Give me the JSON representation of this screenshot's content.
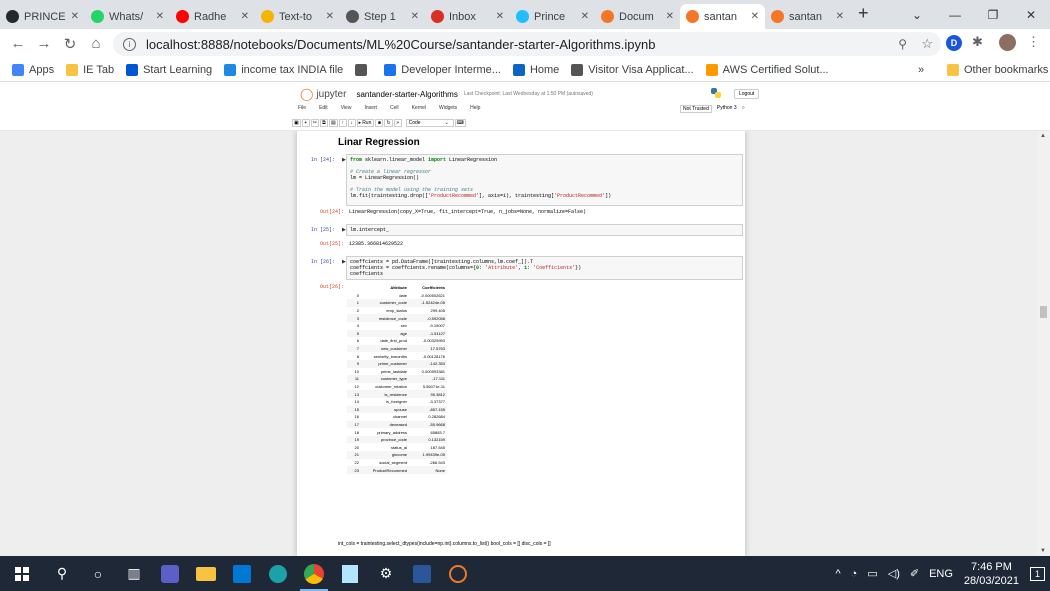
{
  "tabs": [
    {
      "label": "PRINCE",
      "icon": "github-icon",
      "color": "#24292e"
    },
    {
      "label": "Whats/",
      "icon": "whatsapp-icon",
      "color": "#25d366"
    },
    {
      "label": "Radhe",
      "icon": "youtube-icon",
      "color": "#ff0000"
    },
    {
      "label": "Text-to",
      "icon": "google-drive-icon",
      "color": "#f4b400"
    },
    {
      "label": "Step 1",
      "icon": "github-icon",
      "color": "#555555"
    },
    {
      "label": "Inbox",
      "icon": "gmail-icon",
      "color": "#d93025"
    },
    {
      "label": "Prince",
      "icon": "kaggle-icon",
      "color": "#20beff"
    },
    {
      "label": "Docum",
      "icon": "jupyter-icon",
      "color": "#f37726"
    },
    {
      "label": "santan",
      "icon": "notebook-icon",
      "color": "#f37726"
    },
    {
      "label": "santan",
      "icon": "notebook-icon",
      "color": "#f37726"
    }
  ],
  "active_tab": 8,
  "url": "localhost:8888/notebooks/Documents/ML%20Course/santander-starter-Algorithms.ipynb",
  "bookmarks": [
    {
      "label": "Apps",
      "icon": "apps-grid-icon",
      "color": "#4285f4"
    },
    {
      "label": "IE Tab",
      "icon": "folder-icon",
      "color": "#f6c343"
    },
    {
      "label": "Start Learning",
      "icon": "coursera-icon",
      "color": "#0056d2"
    },
    {
      "label": "income tax INDIA file",
      "icon": "ie-icon",
      "color": "#1e88e5"
    },
    {
      "label": "",
      "icon": "globe-icon",
      "color": "#555555"
    },
    {
      "label": "Developer Interme...",
      "icon": "developer-icon",
      "color": "#1a73e8"
    },
    {
      "label": "Home",
      "icon": "linkedin-icon",
      "color": "#0a66c2"
    },
    {
      "label": "Visitor Visa Applicat...",
      "icon": "globe-icon",
      "color": "#555555"
    },
    {
      "label": "AWS Certified Solut...",
      "icon": "aws-icon",
      "color": "#ff9900"
    }
  ],
  "other_bookmarks": "Other bookmarks",
  "jupyter": {
    "title": "santander-starter-Algorithms",
    "checkpoint": "Last Checkpoint: Last Wednesday at 1:50 PM  (autosaved)",
    "logout": "Logout",
    "menus": [
      "File",
      "Edit",
      "View",
      "Insert",
      "Cell",
      "Kernel",
      "Widgets",
      "Help"
    ],
    "trusted": "Not Trusted",
    "kernel": "Python 3",
    "run": "Run",
    "celltype": "Code"
  },
  "notebook": {
    "heading": "Linar Regression",
    "cell1": {
      "prompt": "In [24]:",
      "out_prompt": "Out[24]:",
      "output": "LinearRegression(copy_X=True, fit_intercept=True, n_jobs=None, normalize=False)"
    },
    "cell2": {
      "prompt": "In [25]:",
      "code": "lm.intercept_",
      "out_prompt": "Out[25]:",
      "output": "12385.366814629522"
    },
    "cell3": {
      "prompt": "In [26]:",
      "out_prompt": "Out[26]:"
    },
    "table": {
      "columns": [
        "",
        "Attribute",
        "Coefficients"
      ],
      "rows": [
        [
          "0",
          "date",
          "-0.000502621"
        ],
        [
          "1",
          "customer_code",
          "-1.52424e-05"
        ],
        [
          "2",
          "emp_status",
          "299.405"
        ],
        [
          "3",
          "residence_code",
          "-0.592058"
        ],
        [
          "4",
          "sex",
          "-9.15007"
        ],
        [
          "5",
          "age",
          "-1.51127"
        ],
        [
          "6",
          "date_first_prod",
          "-0.00325953"
        ],
        [
          "7",
          "new_customer",
          "17.5763"
        ],
        [
          "8",
          "seniority_inmonths",
          "-0.00128176"
        ],
        [
          "9",
          "prime_customer",
          "-142.353"
        ],
        [
          "10",
          "prime_lastdate",
          "0.000593381"
        ],
        [
          "11",
          "customer_type",
          "-17.111"
        ],
        [
          "12",
          "customer_relation",
          "5.56071e-11"
        ],
        [
          "13",
          "is_residence",
          "95.3812"
        ],
        [
          "14",
          "is_foreigner",
          "-3.37377"
        ],
        [
          "15",
          "spouse",
          "-857.155"
        ],
        [
          "16",
          "channel",
          "0.282684"
        ],
        [
          "17",
          "deceased",
          "-55.9668"
        ],
        [
          "18",
          "primary_address",
          "65883.7"
        ],
        [
          "19",
          "province_code",
          "0.132159"
        ],
        [
          "20",
          "status_ai",
          "187.545"
        ],
        [
          "21",
          "gincome",
          "1.99439e-05"
        ],
        [
          "22",
          "social_segment",
          "-266.543"
        ],
        [
          "23",
          "ProductRecommed",
          "None"
        ]
      ]
    },
    "md1": "int_cols = traintesting.select_dtypes(include=np.int).columns.to_list() bool_cols = [] disc_cols = []"
  },
  "taskbar": {
    "lang": "ENG",
    "time": "7:46 PM",
    "date": "28/03/2021",
    "notif": "1"
  }
}
